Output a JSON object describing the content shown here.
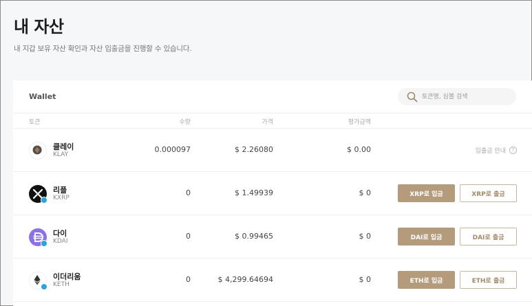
{
  "page": {
    "title": "내 자산",
    "subtitle": "내 지갑 보유 자산 확인과 자산 입출금을 진행할 수 있습니다."
  },
  "wallet": {
    "title": "Wallet",
    "search_placeholder": "토큰명, 심볼 검색",
    "columns": {
      "token": "토큰",
      "amount": "수량",
      "price": "가격",
      "value": "평가금액"
    },
    "rows": [
      {
        "name": "클레이",
        "symbol": "KLAY",
        "amount": "0.000097",
        "price": "$ 2.26080",
        "value": "$ 0.00",
        "guide": "입출금 안내",
        "guide_icon": "question-icon"
      },
      {
        "name": "리플",
        "symbol": "KXRP",
        "amount": "0",
        "price": "$ 1.49939",
        "value": "$ 0",
        "deposit": "XRP로 입금",
        "withdraw": "XRP로 출금"
      },
      {
        "name": "다이",
        "symbol": "KDAI",
        "amount": "0",
        "price": "$ 0.99465",
        "value": "$ 0",
        "deposit": "DAI로 입금",
        "withdraw": "DAI로 출금"
      },
      {
        "name": "이더리움",
        "symbol": "KETH",
        "amount": "0",
        "price": "$ 4,299.64694",
        "value": "$ 0",
        "deposit": "ETH로 입금",
        "withdraw": "ETH로 출금"
      }
    ]
  },
  "colors": {
    "accent": "#b49b7c",
    "dai": "#8b72e6"
  }
}
